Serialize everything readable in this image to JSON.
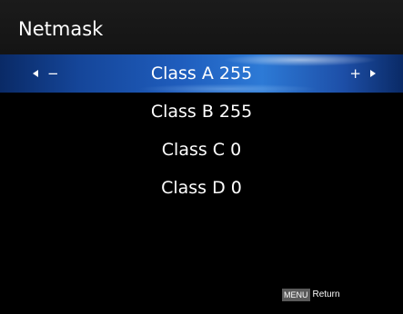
{
  "header": {
    "title": "Netmask"
  },
  "menu": {
    "items": [
      {
        "label": "Class A 255",
        "selected": true
      },
      {
        "label": "Class B 255",
        "selected": false
      },
      {
        "label": "Class C 0",
        "selected": false
      },
      {
        "label": "Class D 0",
        "selected": false
      }
    ],
    "controls": {
      "decrease_symbol": "−",
      "increase_symbol": "+",
      "left_icon": "arrow-left-icon",
      "right_icon": "arrow-right-icon"
    }
  },
  "footer": {
    "key_label": "MENU",
    "action_label": "Return"
  },
  "colors": {
    "background": "#000000",
    "header": "#1b1b1b",
    "highlight": "#1f5dbd",
    "text": "#ffffff",
    "key_badge": "#5a5a5a"
  }
}
